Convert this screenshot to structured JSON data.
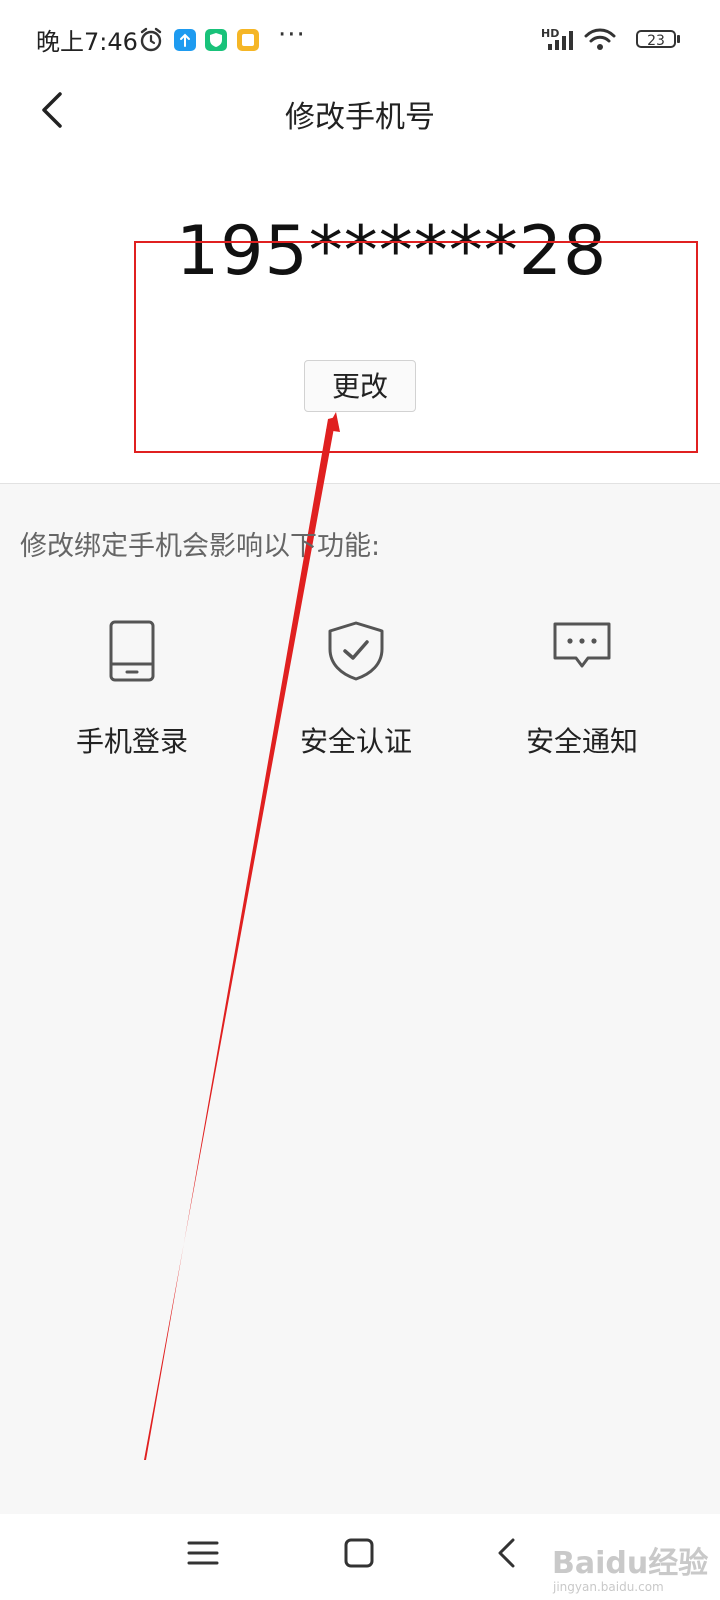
{
  "status_bar": {
    "time": "晚上7:46",
    "more": "···",
    "network": "HD",
    "battery": "23",
    "icons": [
      "alarm-icon",
      "upload-app-icon",
      "security-app-icon",
      "gallery-app-icon",
      "signal-icon",
      "wifi-icon",
      "battery-icon"
    ]
  },
  "header": {
    "title": "修改手机号",
    "back_icon": "chevron-left-icon"
  },
  "account": {
    "phone": "195******28",
    "change_label": "更改"
  },
  "info": {
    "text": "修改绑定手机会影响以下功能:",
    "features": [
      {
        "label": "手机登录",
        "icon": "phone-icon"
      },
      {
        "label": "安全认证",
        "icon": "shield-check-icon"
      },
      {
        "label": "安全通知",
        "icon": "message-icon"
      }
    ]
  },
  "nav_bar": {
    "icons": [
      "menu-icon",
      "home-icon",
      "back-icon"
    ]
  },
  "watermark": {
    "text": "Baidu经验",
    "sub": "jingyan.baidu.com"
  },
  "colors": {
    "annotation_red": "#e02020",
    "background": "#f7f7f7",
    "header_bg": "#ffffff"
  }
}
